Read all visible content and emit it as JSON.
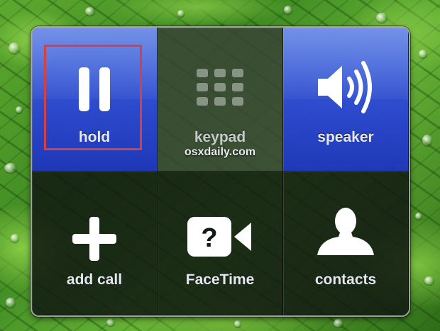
{
  "buttons": {
    "hold": {
      "label": "hold",
      "icon": "pause-icon",
      "state": "active"
    },
    "keypad": {
      "label": "keypad",
      "icon": "keypad-grid-icon",
      "state": "disabled"
    },
    "speaker": {
      "label": "speaker",
      "icon": "speaker-icon",
      "state": "active"
    },
    "add_call": {
      "label": "add call",
      "icon": "plus-icon"
    },
    "facetime": {
      "label": "FaceTime",
      "icon": "facetime-camera-icon",
      "icon_glyph": "?"
    },
    "contacts": {
      "label": "contacts",
      "icon": "contact-silhouette-icon"
    }
  },
  "watermark": "osxdaily.com",
  "colors": {
    "active_button": "#2f4fd8",
    "highlight_box": "#d64040",
    "label_text": "#e4e8ee"
  }
}
